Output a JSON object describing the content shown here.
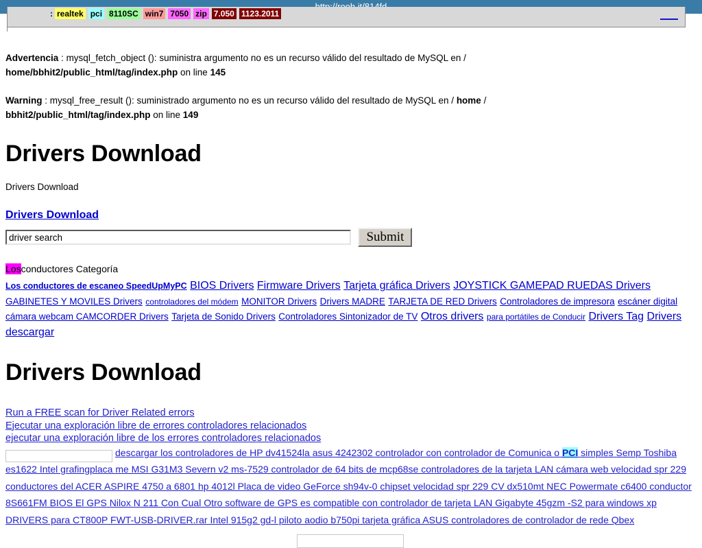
{
  "browser": {
    "url": "http://rooh.it/814fd"
  },
  "tagstrip": {
    "prefix": ":",
    "tags": [
      {
        "label": "realtek",
        "bg": "#ffff66",
        "fg": "#000000"
      },
      {
        "label": "pci",
        "bg": "#99ffff",
        "fg": "#000000"
      },
      {
        "label": "8110SC",
        "bg": "#99ff99",
        "fg": "#000000"
      },
      {
        "label": "win7",
        "bg": "#ff9999",
        "fg": "#000000"
      },
      {
        "label": "7050",
        "bg": "#ff66ff",
        "fg": "#000000"
      },
      {
        "label": "zip",
        "bg": "#ff66ff",
        "fg": "#000000"
      },
      {
        "label": "7.050",
        "bg": "#800000",
        "fg": "#ffffff"
      },
      {
        "label": "1123.2011",
        "bg": "#800000",
        "fg": "#ffffff"
      }
    ]
  },
  "php_warnings": [
    {
      "label": "Advertencia",
      "sep": " : ",
      "text1": "mysql_fetch_object (): suministra argumento no es un recurso válido del resultado de MySQL en /",
      "path": "home/bbhit2/public_html/tag/index.php",
      "online": " on line ",
      "line": "145"
    },
    {
      "label": "Warning",
      "sep": " : ",
      "text1": "mysql_free_result (): suministrado argumento no es un recurso válido del resultado de MySQL en / ",
      "pathbold1": "home",
      "pathsep": " / ",
      "path": "bbhit2/public_html/tag/index.php",
      "online": " on line ",
      "line": "149"
    }
  ],
  "headings": {
    "title1": "Drivers Download",
    "subtitle": "Drivers Download",
    "link_title": "Drivers Download",
    "title2": "Drivers Download"
  },
  "search": {
    "value": "driver search",
    "placeholder": "driver search",
    "submit_label": "Submit"
  },
  "category": {
    "highlight": "Los",
    "heading_rest": "conductores Categoría",
    "links": [
      {
        "label": "Los conductores de escaneo SpeedUpMyPC",
        "size": "cl-bold"
      },
      {
        "label": "BIOS Drivers",
        "size": "cl-norm"
      },
      {
        "label": "Firmware Drivers",
        "size": "cl-norm"
      },
      {
        "label": "Tarjeta gráfica Drivers",
        "size": "cl-norm"
      },
      {
        "label": "JOYSTICK GAMEPAD RUEDAS Drivers",
        "size": "cl-norm"
      },
      {
        "label": "GABINETES Y MOVILES Drivers",
        "size": "cl-mid"
      },
      {
        "label": "controladores del módem",
        "size": "cl-small"
      },
      {
        "label": "MONITOR Drivers",
        "size": "cl-mid"
      },
      {
        "label": "Drivers MADRE",
        "size": "cl-mid"
      },
      {
        "label": "TARJETA DE RED Drivers",
        "size": "cl-mid"
      },
      {
        "label": "Controladores de impresora",
        "size": "cl-mid"
      },
      {
        "label": "escáner digital",
        "size": "cl-mid"
      },
      {
        "label": "cámara webcam CAMCORDER Drivers",
        "size": "cl-mid"
      },
      {
        "label": "Tarjeta de Sonido Drivers",
        "size": "cl-mid"
      },
      {
        "label": "Controladores Sintonizador de TV",
        "size": "cl-mid"
      },
      {
        "label": "Otros drivers",
        "size": "cl-norm"
      },
      {
        "label": "para portátiles de Conducir",
        "size": "cl-small"
      },
      {
        "label": "Drivers Tag",
        "size": "cl-norm"
      },
      {
        "label": "Drivers descargar",
        "size": "cl-norm"
      }
    ]
  },
  "scan_links": [
    "Run a FREE scan for Driver Related errors",
    "Ejecutar una exploración libre de errores controladores relacionados ",
    "ejecutar una exploración libre de los errores controladores relacionados "
  ],
  "keyword_block": {
    "input_value": "",
    "highlight_word": "PCI",
    "segments_before": [
      {
        "text": "descargar los controladores de HP dv41524la asus 4242302 controlador con controlador de Comunica o ",
        "size": "kw-lg"
      }
    ],
    "segments_after": [
      {
        "text": " simples Semp Toshiba es1622 Intel grafingplaca me MSI G31M3 Severn v2 ms-7529 controlador de 64 bits de mcp68se controladores de la tarjeta LAN cámara web velocidad spr 229 conductores del ACER ASPIRE 4750 a 6801 hp 4012l Placa de video GeForce sh94v-0 chipset velocidad spr 229 CV dx510mt NEC Powermate c6400 conductor 8S661FM BIOS El GPS Nilox N 211 Con Cual Otro software de GPS es compatible con controlador de tarjeta LAN Gigabyte 45gzm -S2 para windows xp DRIVERS para CT800P FWT-USB-DRIVER.rar Intel 915g2 gd-l piloto aodio b750pi tarjeta gráfica ASUS controladores de controlador de rede Qbex",
        "size": "kw-lg"
      }
    ]
  },
  "bottom_input": {
    "value": "",
    "placeholder": ""
  }
}
